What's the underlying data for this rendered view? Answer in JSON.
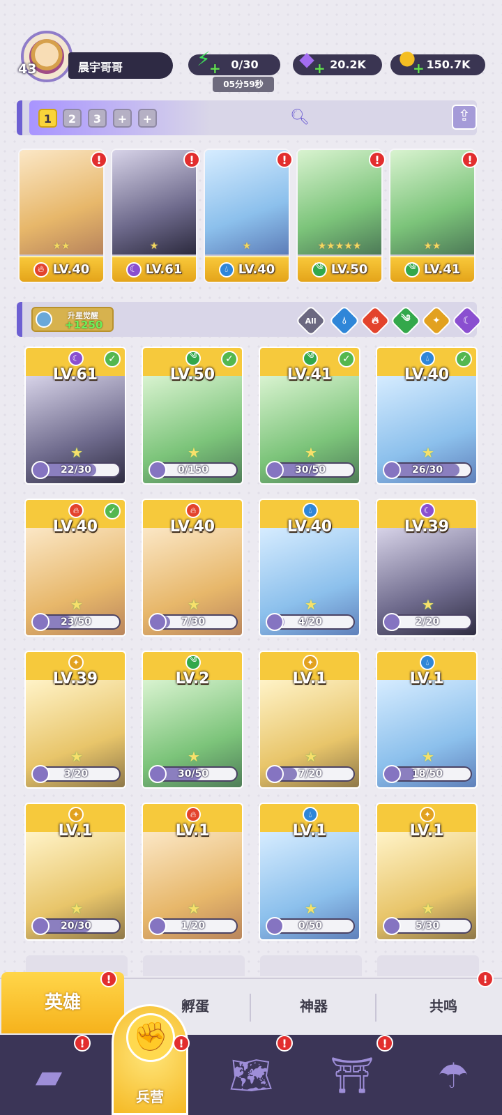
{
  "player": {
    "level": "43",
    "name": "晨宇哥哥"
  },
  "resources": {
    "energy": {
      "value": "0/30",
      "icon": "lightning-icon",
      "timer": "05分59秒"
    },
    "gems": {
      "value": "20.2K",
      "icon": "gem-icon"
    },
    "coins": {
      "value": "150.7K",
      "icon": "coin-icon"
    }
  },
  "team": {
    "slots": [
      "1",
      "2",
      "3",
      "+",
      "+"
    ],
    "active_slot": "1",
    "heroes": [
      {
        "level": "LV.40",
        "element": "fire",
        "stars": "★★",
        "alert": "!"
      },
      {
        "level": "LV.61",
        "element": "dark",
        "stars": "★",
        "alert": "!"
      },
      {
        "level": "LV.40",
        "element": "water",
        "stars": "★",
        "alert": "!"
      },
      {
        "level": "LV.50",
        "element": "wind",
        "stars": "★★★★★",
        "alert": "!"
      },
      {
        "level": "LV.41",
        "element": "wind",
        "stars": "★★",
        "alert": "!"
      }
    ]
  },
  "filter": {
    "awaken_label": "升星觉醒",
    "awaken_count": "+1250",
    "all_label": "All",
    "elements": [
      "water",
      "fire",
      "wind",
      "light",
      "dark"
    ]
  },
  "roster": [
    {
      "level": "LV.61",
      "element": "dark",
      "progress": "22/30",
      "ratio": 0.73,
      "check": true
    },
    {
      "level": "LV.50",
      "element": "wind",
      "progress": "0/150",
      "ratio": 0.0,
      "check": true
    },
    {
      "level": "LV.41",
      "element": "wind",
      "progress": "30/50",
      "ratio": 0.6,
      "check": true
    },
    {
      "level": "LV.40",
      "element": "water",
      "progress": "26/30",
      "ratio": 0.87,
      "check": true
    },
    {
      "level": "LV.40",
      "element": "fire",
      "progress": "23/50",
      "ratio": 0.46,
      "check": true
    },
    {
      "level": "LV.40",
      "element": "fire",
      "progress": "7/30",
      "ratio": 0.23,
      "check": false
    },
    {
      "level": "LV.40",
      "element": "water",
      "progress": "4/20",
      "ratio": 0.2,
      "check": false
    },
    {
      "level": "LV.39",
      "element": "dark",
      "progress": "2/20",
      "ratio": 0.1,
      "check": false
    },
    {
      "level": "LV.39",
      "element": "light",
      "progress": "3/20",
      "ratio": 0.15,
      "check": false
    },
    {
      "level": "LV.2",
      "element": "wind",
      "progress": "30/50",
      "ratio": 0.6,
      "check": false
    },
    {
      "level": "LV.1",
      "element": "light",
      "progress": "7/20",
      "ratio": 0.35,
      "check": false
    },
    {
      "level": "LV.1",
      "element": "water",
      "progress": "18/50",
      "ratio": 0.36,
      "check": false
    },
    {
      "level": "LV.1",
      "element": "light",
      "progress": "20/30",
      "ratio": 0.67,
      "check": false
    },
    {
      "level": "LV.1",
      "element": "fire",
      "progress": "1/20",
      "ratio": 0.05,
      "check": false
    },
    {
      "level": "LV.1",
      "element": "water",
      "progress": "0/50",
      "ratio": 0.0,
      "check": false
    },
    {
      "level": "LV.1",
      "element": "light",
      "progress": "5/30",
      "ratio": 0.17,
      "check": false
    }
  ],
  "tabs": {
    "heroes": "英雄",
    "hatch": "孵蛋",
    "artifacts": "神器",
    "resonance": "共鸣"
  },
  "nav": {
    "barracks": "兵营"
  },
  "colors": {
    "fire": "#e3432c",
    "water": "#2f86d8",
    "wind": "#33a84b",
    "light": "#e2a11f",
    "dark": "#8a4fd0"
  }
}
